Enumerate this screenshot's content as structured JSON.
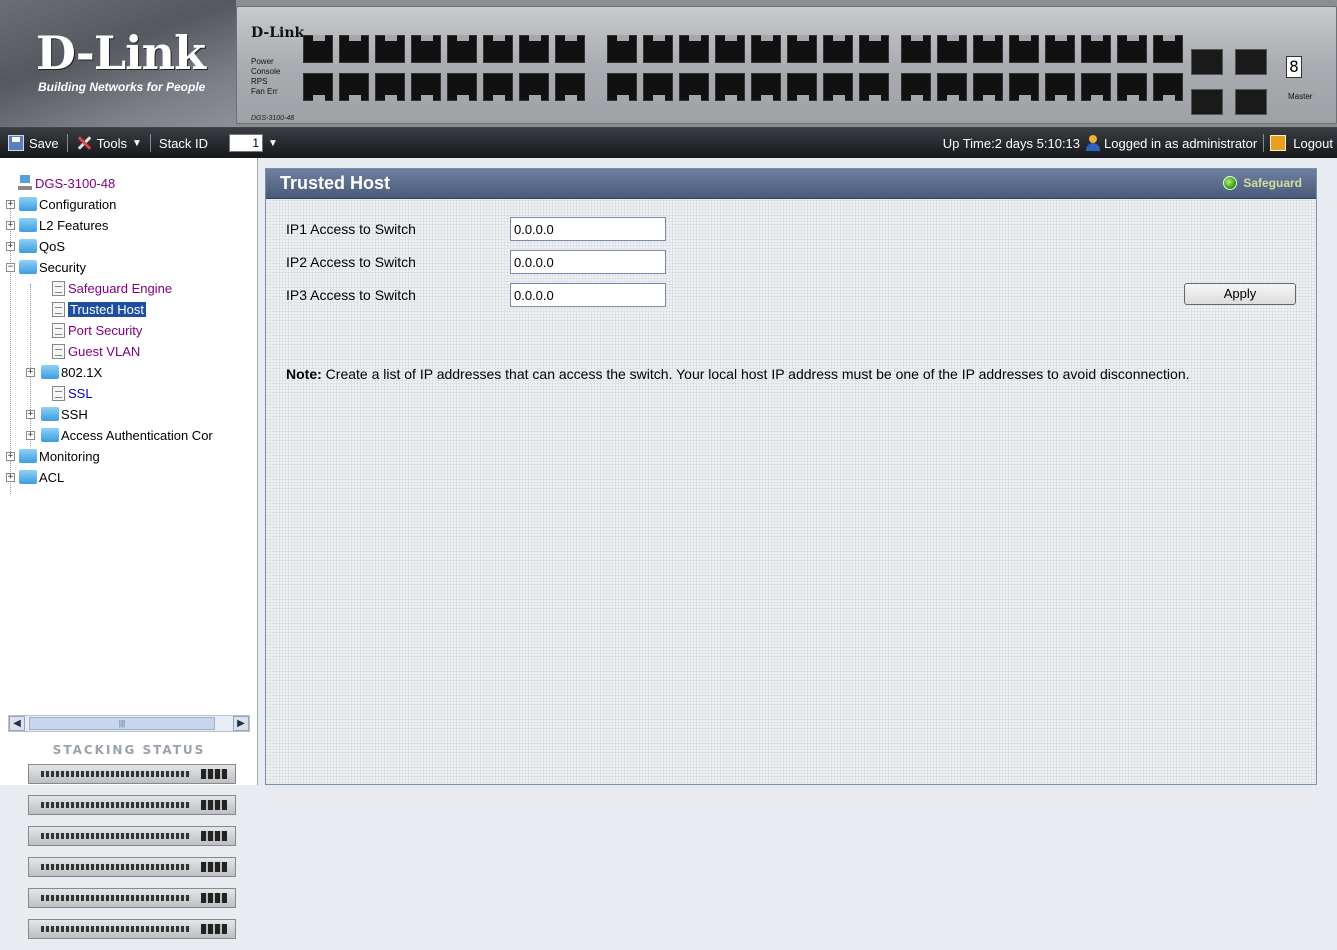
{
  "banner": {
    "logo": "D-Link",
    "tagline": "Building Networks for People",
    "panel_brand": "D-Link",
    "leds": [
      "Power",
      "Console",
      "RPS",
      "Fan Err"
    ],
    "model": "DGS-3100-48",
    "stack_digit": "8",
    "master_label": "Master"
  },
  "toolbar": {
    "save": "Save",
    "tools": "Tools",
    "stack_id_label": "Stack ID",
    "stack_id_value": "1",
    "uptime": "Up Time:2 days 5:10:13",
    "logged_in": "Logged in as administrator",
    "logout": "Logout"
  },
  "tree": {
    "root": "DGS-3100-48",
    "items": {
      "configuration": "Configuration",
      "l2": "L2 Features",
      "qos": "QoS",
      "security": "Security",
      "safeguard": "Safeguard Engine",
      "trusted_host": "Trusted Host",
      "port_security": "Port Security",
      "guest_vlan": "Guest VLAN",
      "dot1x": "802.1X",
      "ssl": "SSL",
      "ssh": "SSH",
      "access_auth": "Access Authentication Cor",
      "monitoring": "Monitoring",
      "acl": "ACL"
    }
  },
  "stacking": {
    "title": "STACKING STATUS",
    "units": 6
  },
  "main": {
    "title": "Trusted Host",
    "safeguard_label": "Safeguard",
    "fields": [
      {
        "label": "IP1 Access to Switch",
        "value": "0.0.0.0"
      },
      {
        "label": "IP2 Access to Switch",
        "value": "0.0.0.0"
      },
      {
        "label": "IP3 Access to Switch",
        "value": "0.0.0.0"
      }
    ],
    "apply": "Apply",
    "note_label": "Note:",
    "note_text": "Create a list of IP addresses that can access the switch. Your local host IP address must be one of the IP addresses to avoid disconnection."
  },
  "colors": {
    "header_bar": "#4a5a78",
    "selected": "#1f4ea0",
    "visited_link": "#800080",
    "safeguard_led": "#3ea018"
  }
}
